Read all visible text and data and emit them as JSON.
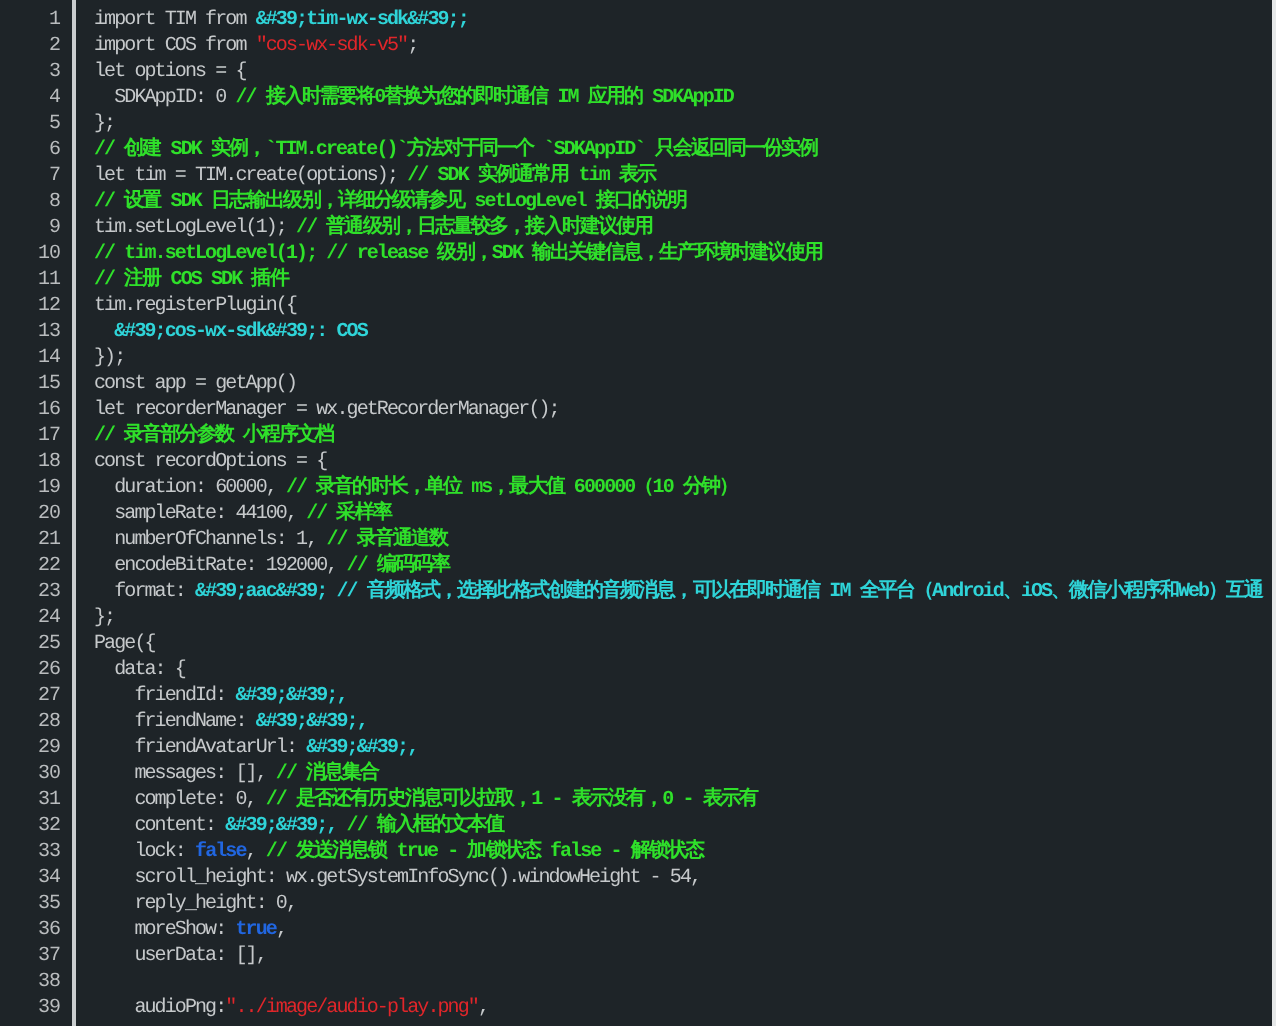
{
  "editor": {
    "lines": [
      {
        "number": "1",
        "tokens": [
          {
            "kind": "plain",
            "text": "import TIM from "
          },
          {
            "kind": "string",
            "text": "&#39;tim-wx-sdk&#39;;"
          }
        ]
      },
      {
        "number": "2",
        "tokens": [
          {
            "kind": "plain",
            "text": "import COS from "
          },
          {
            "kind": "literal",
            "text": "\"cos-wx-sdk-v5\""
          },
          {
            "kind": "plain",
            "text": ";"
          }
        ]
      },
      {
        "number": "3",
        "tokens": [
          {
            "kind": "plain",
            "text": "let options = {"
          }
        ]
      },
      {
        "number": "4",
        "tokens": [
          {
            "kind": "plain",
            "text": "  SDKAppID: 0 "
          },
          {
            "kind": "comment",
            "text": "// 接入时需要将0替换为您的即时通信 IM 应用的 SDKAppID"
          }
        ]
      },
      {
        "number": "5",
        "tokens": [
          {
            "kind": "plain",
            "text": "};"
          }
        ]
      },
      {
        "number": "6",
        "tokens": [
          {
            "kind": "comment",
            "text": "// 创建 SDK 实例，`TIM.create()`方法对于同一个 `SDKAppID` 只会返回同一份实例"
          }
        ]
      },
      {
        "number": "7",
        "tokens": [
          {
            "kind": "plain",
            "text": "let tim = TIM.create(options); "
          },
          {
            "kind": "comment",
            "text": "// SDK 实例通常用 tim 表示"
          }
        ]
      },
      {
        "number": "8",
        "tokens": [
          {
            "kind": "comment",
            "text": "// 设置 SDK 日志输出级别，详细分级请参见 setLogLevel 接口的说明"
          }
        ]
      },
      {
        "number": "9",
        "tokens": [
          {
            "kind": "plain",
            "text": "tim.setLogLevel(1); "
          },
          {
            "kind": "comment",
            "text": "// 普通级别，日志量较多，接入时建议使用"
          }
        ]
      },
      {
        "number": "10",
        "tokens": [
          {
            "kind": "comment",
            "text": "// tim.setLogLevel(1); // release 级别，SDK 输出关键信息，生产环境时建议使用"
          }
        ]
      },
      {
        "number": "11",
        "tokens": [
          {
            "kind": "comment",
            "text": "// 注册 COS SDK 插件"
          }
        ]
      },
      {
        "number": "12",
        "tokens": [
          {
            "kind": "plain",
            "text": "tim.registerPlugin({"
          }
        ]
      },
      {
        "number": "13",
        "tokens": [
          {
            "kind": "string",
            "text": "  &#39;cos-wx-sdk&#39;: COS"
          }
        ]
      },
      {
        "number": "14",
        "tokens": [
          {
            "kind": "plain",
            "text": "});"
          }
        ]
      },
      {
        "number": "15",
        "tokens": [
          {
            "kind": "plain",
            "text": "const app = getApp()"
          }
        ]
      },
      {
        "number": "16",
        "tokens": [
          {
            "kind": "plain",
            "text": "let recorderManager = wx.getRecorderManager();"
          }
        ]
      },
      {
        "number": "17",
        "tokens": [
          {
            "kind": "comment",
            "text": "// 录音部分参数 小程序文档"
          }
        ]
      },
      {
        "number": "18",
        "tokens": [
          {
            "kind": "plain",
            "text": "const recordOptions = {"
          }
        ]
      },
      {
        "number": "19",
        "tokens": [
          {
            "kind": "plain",
            "text": "  duration: 60000, "
          },
          {
            "kind": "comment",
            "text": "// 录音的时长，单位 ms，最大值 600000（10 分钟）"
          }
        ]
      },
      {
        "number": "20",
        "tokens": [
          {
            "kind": "plain",
            "text": "  sampleRate: 44100, "
          },
          {
            "kind": "comment",
            "text": "// 采样率"
          }
        ]
      },
      {
        "number": "21",
        "tokens": [
          {
            "kind": "plain",
            "text": "  numberOfChannels: 1, "
          },
          {
            "kind": "comment",
            "text": "// 录音通道数"
          }
        ]
      },
      {
        "number": "22",
        "tokens": [
          {
            "kind": "plain",
            "text": "  encodeBitRate: 192000, "
          },
          {
            "kind": "comment",
            "text": "// 编码码率"
          }
        ]
      },
      {
        "number": "23",
        "tokens": [
          {
            "kind": "plain",
            "text": "  format: "
          },
          {
            "kind": "string",
            "text": "&#39;aac&#39; // 音频格式，选择此格式创建的音频消息，可以在即时通信 IM 全平台（Android、iOS、微信小程序和Web）互通"
          }
        ]
      },
      {
        "number": "24",
        "tokens": [
          {
            "kind": "plain",
            "text": "};"
          }
        ]
      },
      {
        "number": "25",
        "tokens": [
          {
            "kind": "plain",
            "text": "Page({"
          }
        ]
      },
      {
        "number": "26",
        "tokens": [
          {
            "kind": "plain",
            "text": "  data: {"
          }
        ]
      },
      {
        "number": "27",
        "tokens": [
          {
            "kind": "plain",
            "text": "    friendId: "
          },
          {
            "kind": "string",
            "text": "&#39;&#39;,"
          }
        ]
      },
      {
        "number": "28",
        "tokens": [
          {
            "kind": "plain",
            "text": "    friendName: "
          },
          {
            "kind": "string",
            "text": "&#39;&#39;,"
          }
        ]
      },
      {
        "number": "29",
        "tokens": [
          {
            "kind": "plain",
            "text": "    friendAvatarUrl: "
          },
          {
            "kind": "string",
            "text": "&#39;&#39;,"
          }
        ]
      },
      {
        "number": "30",
        "tokens": [
          {
            "kind": "plain",
            "text": "    messages: [], "
          },
          {
            "kind": "comment",
            "text": "// 消息集合"
          }
        ]
      },
      {
        "number": "31",
        "tokens": [
          {
            "kind": "plain",
            "text": "    complete: 0, "
          },
          {
            "kind": "comment",
            "text": "// 是否还有历史消息可以拉取，1 - 表示没有，0 - 表示有"
          }
        ]
      },
      {
        "number": "32",
        "tokens": [
          {
            "kind": "plain",
            "text": "    content: "
          },
          {
            "kind": "string",
            "text": "&#39;&#39;,"
          },
          {
            "kind": "comment",
            "text": " // 输入框的文本值"
          }
        ]
      },
      {
        "number": "33",
        "tokens": [
          {
            "kind": "plain",
            "text": "    lock: "
          },
          {
            "kind": "keyword",
            "text": "false"
          },
          {
            "kind": "plain",
            "text": ", "
          },
          {
            "kind": "comment",
            "text": "// 发送消息锁 true - 加锁状态 false - 解锁状态"
          }
        ]
      },
      {
        "number": "34",
        "tokens": [
          {
            "kind": "plain",
            "text": "    scroll_height: wx.getSystemInfoSync().windowHeight - 54,"
          }
        ]
      },
      {
        "number": "35",
        "tokens": [
          {
            "kind": "plain",
            "text": "    reply_height: 0,"
          }
        ]
      },
      {
        "number": "36",
        "tokens": [
          {
            "kind": "plain",
            "text": "    moreShow: "
          },
          {
            "kind": "keyword",
            "text": "true"
          },
          {
            "kind": "plain",
            "text": ","
          }
        ]
      },
      {
        "number": "37",
        "tokens": [
          {
            "kind": "plain",
            "text": "    userData: [],"
          }
        ]
      },
      {
        "number": "38"
      },
      {
        "number": "39",
        "tokens": [
          {
            "kind": "plain",
            "text": "    audioPng:"
          },
          {
            "kind": "literal",
            "text": "\"../image/audio-play.png\""
          },
          {
            "kind": "plain",
            "text": ","
          }
        ]
      }
    ]
  }
}
